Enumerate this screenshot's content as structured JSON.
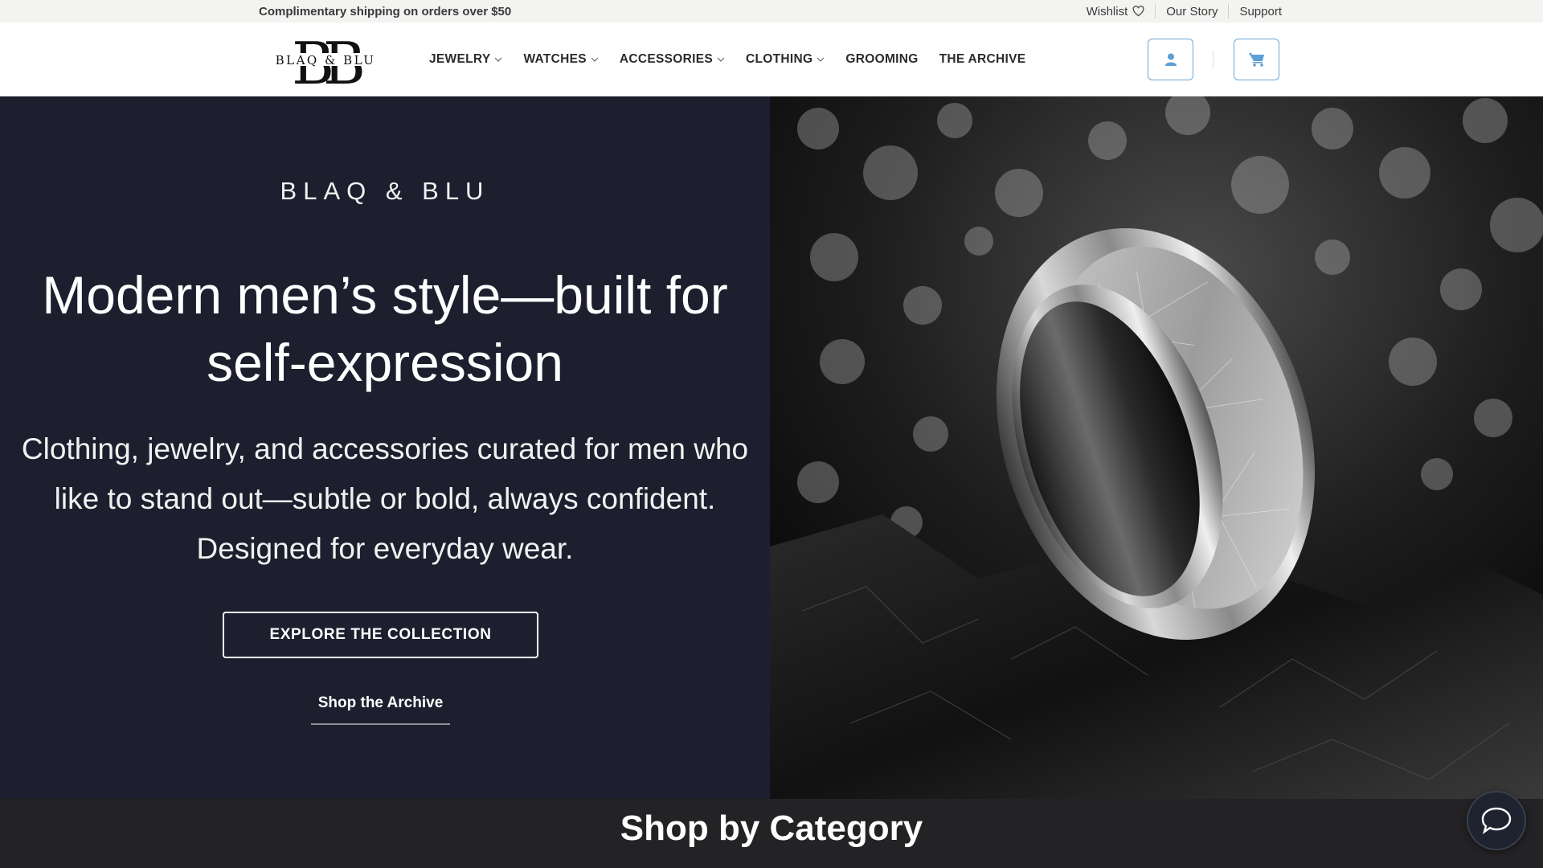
{
  "topbar": {
    "promo": "Complimentary shipping on orders over $50",
    "links": [
      {
        "label": "Wishlist",
        "icon": "heart-icon"
      },
      {
        "label": "Our Story"
      },
      {
        "label": "Support"
      }
    ]
  },
  "header": {
    "logo_monogram": "BB",
    "logo_text": "BLAQ & BLU",
    "nav": [
      {
        "label": "JEWELRY",
        "has_dropdown": true
      },
      {
        "label": "WATCHES",
        "has_dropdown": true
      },
      {
        "label": "ACCESSORIES",
        "has_dropdown": true
      },
      {
        "label": "CLOTHING",
        "has_dropdown": true
      },
      {
        "label": "GROOMING",
        "has_dropdown": false
      },
      {
        "label": "THE ARCHIVE",
        "has_dropdown": false
      }
    ],
    "account_icon": "user-icon",
    "cart_icon": "cart-icon"
  },
  "hero": {
    "kicker": "BLAQ & BLU",
    "title": "Modern men’s style—built for self-expression",
    "subtitle": "Clothing, jewelry, and accessories curated for men who like to stand out—subtle or bold, always confident. Designed for everyday wear.",
    "primary_cta": "EXPLORE THE COLLECTION",
    "secondary_cta": "Shop the Archive"
  },
  "category_section": {
    "title": "Shop by Category"
  },
  "chat": {
    "icon": "chat-bubble-icon"
  },
  "colors": {
    "hero_bg": "#1d1f2e",
    "accent_border": "#6aa7d8",
    "category_bg": "#232325"
  }
}
